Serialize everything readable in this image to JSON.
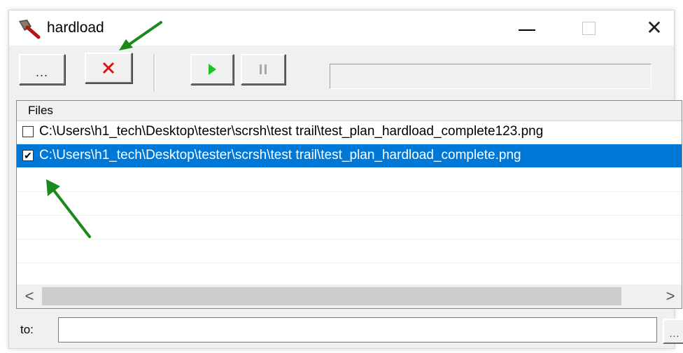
{
  "window": {
    "title": "hardload",
    "minimize_icon": "minimize-icon",
    "maximize_icon": "maximize-icon",
    "close_icon": "close-icon",
    "close_glyph": "✕"
  },
  "toolbar": {
    "browse_label": "...",
    "remove_icon": "remove-x-icon",
    "start_icon": "play-icon",
    "pause_icon": "pause-icon",
    "progress_fraction": 0,
    "progress_color": "#06b025"
  },
  "files": {
    "header": "Files",
    "rows": [
      {
        "checked": false,
        "path": "C:\\Users\\h1_tech\\Desktop\\tester\\scrsh\\test trail\\test_plan_hardload_complete123.png",
        "selected": false
      },
      {
        "checked": true,
        "path": "C:\\Users\\h1_tech\\Desktop\\tester\\scrsh\\test trail\\test_plan_hardload_complete.png",
        "selected": true
      }
    ],
    "scroll_left_glyph": "<",
    "scroll_right_glyph": ">"
  },
  "destination": {
    "label": "to:",
    "value": "",
    "browse_label": "..."
  },
  "colors": {
    "selection": "#0078d7",
    "annotation_arrow": "#1a8a1a",
    "remove_x": "#e01010",
    "play": "#1ec41e"
  }
}
